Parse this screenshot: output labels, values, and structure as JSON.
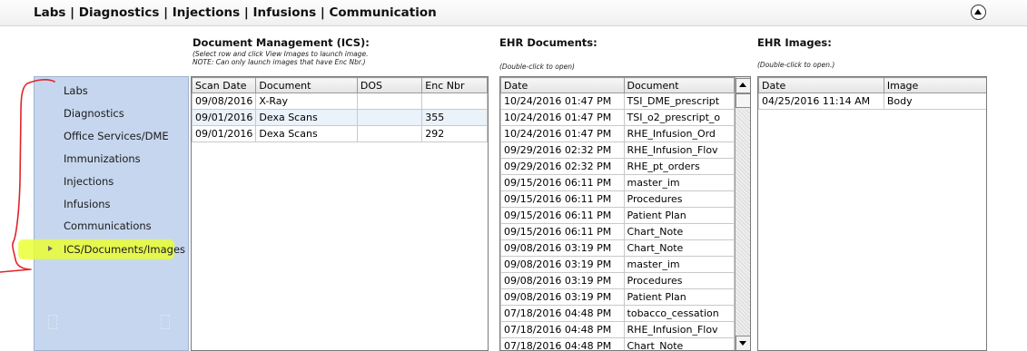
{
  "header": {
    "title": "Labs | Diagnostics | Injections | Infusions | Communication"
  },
  "sections": {
    "ics": {
      "title": "Document Management (ICS):",
      "note1": "(Select row and click View Images to launch image.",
      "note2": "NOTE: Can only launch images that have Enc Nbr.)"
    },
    "ehr_docs": {
      "title": "EHR Documents:",
      "note": "(Double-click to open)"
    },
    "ehr_images": {
      "title": "EHR Images:",
      "note": "(Double-click to open.)"
    }
  },
  "sidebar": {
    "items": [
      {
        "label": "Labs"
      },
      {
        "label": "Diagnostics"
      },
      {
        "label": "Office Services/DME"
      },
      {
        "label": "Immunizations"
      },
      {
        "label": "Injections"
      },
      {
        "label": "Infusions"
      },
      {
        "label": "Communications"
      },
      {
        "label": "ICS/Documents/Images"
      }
    ]
  },
  "ics_table": {
    "columns": [
      "Scan Date",
      "Document",
      "DOS",
      "Enc Nbr"
    ],
    "rows": [
      [
        "09/08/2016",
        "X-Ray",
        "",
        ""
      ],
      [
        "09/01/2016",
        "Dexa Scans",
        "",
        "355"
      ],
      [
        "09/01/2016",
        "Dexa Scans",
        "",
        "292"
      ]
    ]
  },
  "docs_table": {
    "columns": [
      "Date",
      "Document"
    ],
    "rows": [
      [
        "10/24/2016 01:47 PM",
        "TSI_DME_prescript"
      ],
      [
        "10/24/2016 01:47 PM",
        "TSI_o2_prescript_o"
      ],
      [
        "10/24/2016 01:47 PM",
        "RHE_Infusion_Ord"
      ],
      [
        "09/29/2016 02:32 PM",
        "RHE_Infusion_Flov"
      ],
      [
        "09/29/2016 02:32 PM",
        "RHE_pt_orders"
      ],
      [
        "09/15/2016 06:11 PM",
        "master_im"
      ],
      [
        "09/15/2016 06:11 PM",
        "Procedures"
      ],
      [
        "09/15/2016 06:11 PM",
        "Patient Plan"
      ],
      [
        "09/15/2016 06:11 PM",
        "Chart_Note"
      ],
      [
        "09/08/2016 03:19 PM",
        "Chart_Note"
      ],
      [
        "09/08/2016 03:19 PM",
        "master_im"
      ],
      [
        "09/08/2016 03:19 PM",
        "Procedures"
      ],
      [
        "09/08/2016 03:19 PM",
        "Patient Plan"
      ],
      [
        "07/18/2016 04:48 PM",
        "tobacco_cessation"
      ],
      [
        "07/18/2016 04:48 PM",
        "RHE_Infusion_Flov"
      ],
      [
        "07/18/2016 04:48 PM",
        "Chart_Note"
      ]
    ]
  },
  "images_table": {
    "columns": [
      "Date",
      "Image"
    ],
    "rows": [
      [
        "04/25/2016 11:14 AM",
        "Body"
      ]
    ]
  }
}
